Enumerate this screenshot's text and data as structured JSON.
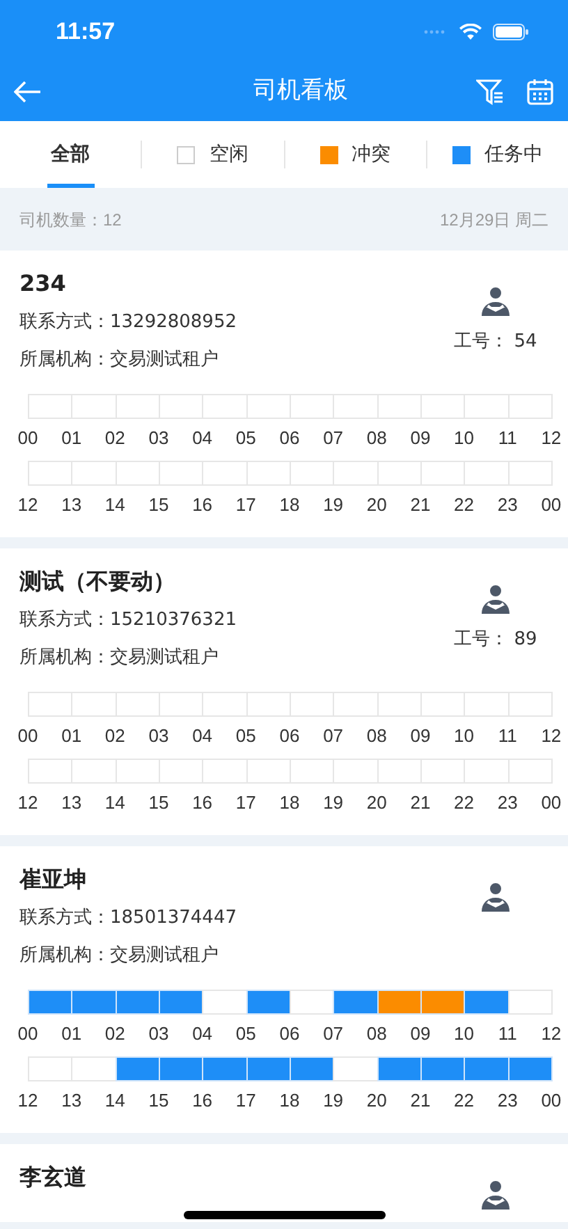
{
  "status_bar": {
    "time": "11:57"
  },
  "nav": {
    "title": "司机看板"
  },
  "tabs": [
    {
      "label": "全部",
      "selected": true
    },
    {
      "label": "空闲",
      "selected": false,
      "color": "#ffffff"
    },
    {
      "label": "冲突",
      "selected": false,
      "color": "#fb8c00"
    },
    {
      "label": "任务中",
      "selected": false,
      "color": "#1e8ef7"
    }
  ],
  "summary": {
    "count": "司机数量：12",
    "date": "12月29日 周二"
  },
  "drivers": [
    {
      "name": "234",
      "phone": "联系方式：13292808952",
      "org": "所属机构：交易测试租户",
      "work_id": "工号： 54",
      "timeline": [
        {
          "labels": [
            "00",
            "01",
            "02",
            "03",
            "04",
            "05",
            "06",
            "07",
            "08",
            "09",
            "10",
            "11",
            "12"
          ],
          "slots": [
            {
              "color": "#ffffff"
            },
            {
              "color": "#ffffff"
            },
            {
              "color": "#ffffff"
            },
            {
              "color": "#ffffff"
            },
            {
              "color": "#ffffff"
            },
            {
              "color": "#ffffff"
            },
            {
              "color": "#ffffff"
            },
            {
              "color": "#ffffff"
            },
            {
              "color": "#ffffff"
            },
            {
              "color": "#ffffff"
            },
            {
              "color": "#ffffff"
            },
            {
              "color": "#ffffff"
            }
          ]
        },
        {
          "labels": [
            "12",
            "13",
            "14",
            "15",
            "16",
            "17",
            "18",
            "19",
            "20",
            "21",
            "22",
            "23",
            "00"
          ],
          "slots": [
            {
              "color": "#ffffff"
            },
            {
              "color": "#ffffff"
            },
            {
              "color": "#ffffff"
            },
            {
              "color": "#ffffff"
            },
            {
              "color": "#ffffff"
            },
            {
              "color": "#ffffff"
            },
            {
              "color": "#ffffff"
            },
            {
              "color": "#ffffff"
            },
            {
              "color": "#ffffff"
            },
            {
              "color": "#ffffff"
            },
            {
              "color": "#ffffff"
            },
            {
              "color": "#ffffff"
            }
          ]
        }
      ]
    },
    {
      "name": "测试（不要动）",
      "phone": "联系方式：15210376321",
      "org": "所属机构：交易测试租户",
      "work_id": "工号： 89",
      "timeline": [
        {
          "labels": [
            "00",
            "01",
            "02",
            "03",
            "04",
            "05",
            "06",
            "07",
            "08",
            "09",
            "10",
            "11",
            "12"
          ],
          "slots": [
            {
              "color": "#ffffff"
            },
            {
              "color": "#ffffff"
            },
            {
              "color": "#ffffff"
            },
            {
              "color": "#ffffff"
            },
            {
              "color": "#ffffff"
            },
            {
              "color": "#ffffff"
            },
            {
              "color": "#ffffff"
            },
            {
              "color": "#ffffff"
            },
            {
              "color": "#ffffff"
            },
            {
              "color": "#ffffff"
            },
            {
              "color": "#ffffff"
            },
            {
              "color": "#ffffff"
            }
          ]
        },
        {
          "labels": [
            "12",
            "13",
            "14",
            "15",
            "16",
            "17",
            "18",
            "19",
            "20",
            "21",
            "22",
            "23",
            "00"
          ],
          "slots": [
            {
              "color": "#ffffff"
            },
            {
              "color": "#ffffff"
            },
            {
              "color": "#ffffff"
            },
            {
              "color": "#ffffff"
            },
            {
              "color": "#ffffff"
            },
            {
              "color": "#ffffff"
            },
            {
              "color": "#ffffff"
            },
            {
              "color": "#ffffff"
            },
            {
              "color": "#ffffff"
            },
            {
              "color": "#ffffff"
            },
            {
              "color": "#ffffff"
            },
            {
              "color": "#ffffff"
            }
          ]
        }
      ]
    },
    {
      "name": "崔亚坤",
      "phone": "联系方式：18501374447",
      "org": "所属机构：交易测试租户",
      "timeline": [
        {
          "labels": [
            "00",
            "01",
            "02",
            "03",
            "04",
            "05",
            "06",
            "07",
            "08",
            "09",
            "10",
            "11",
            "12"
          ],
          "slots": [
            {
              "color": "#1e8ef7"
            },
            {
              "color": "#1e8ef7"
            },
            {
              "color": "#1e8ef7"
            },
            {
              "color": "#1e8ef7"
            },
            {
              "color": "#ffffff"
            },
            {
              "color": "#1e8ef7"
            },
            {
              "color": "#ffffff"
            },
            {
              "color": "#1e8ef7"
            },
            {
              "color": "#fb8c00"
            },
            {
              "color": "#fb8c00"
            },
            {
              "color": "#1e8ef7"
            },
            {
              "color": "#ffffff"
            }
          ]
        },
        {
          "labels": [
            "12",
            "13",
            "14",
            "15",
            "16",
            "17",
            "18",
            "19",
            "20",
            "21",
            "22",
            "23",
            "00"
          ],
          "slots": [
            {
              "color": "#ffffff"
            },
            {
              "color": "#ffffff"
            },
            {
              "color": "#1e8ef7"
            },
            {
              "color": "#1e8ef7"
            },
            {
              "color": "#1e8ef7"
            },
            {
              "color": "#1e8ef7"
            },
            {
              "color": "#1e8ef7"
            },
            {
              "color": "#ffffff"
            },
            {
              "color": "#1e8ef7"
            },
            {
              "color": "#1e8ef7"
            },
            {
              "color": "#1e8ef7"
            },
            {
              "color": "#1e8ef7"
            }
          ]
        }
      ]
    },
    {
      "name": "李玄道"
    }
  ]
}
